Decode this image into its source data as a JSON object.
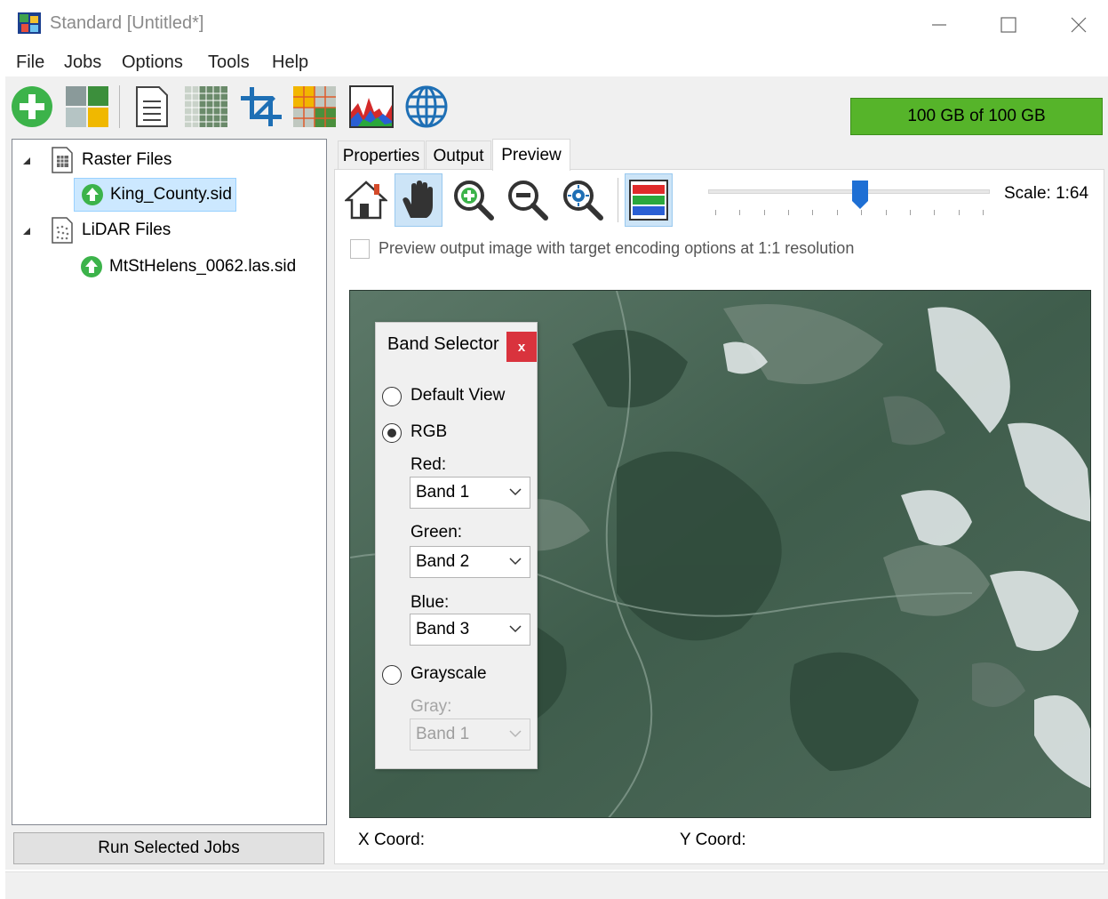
{
  "window": {
    "title": "Standard [Untitled*]"
  },
  "menu": [
    "File",
    "Jobs",
    "Options",
    "Tools",
    "Help"
  ],
  "toolbar": {
    "buttons": [
      {
        "icon": "add-job-icon"
      },
      {
        "icon": "mosaic-icon"
      },
      {
        "icon": "properties-document-icon"
      },
      {
        "icon": "grid-tiles-icon"
      },
      {
        "icon": "crop-icon"
      },
      {
        "icon": "mosaic-grid-icon"
      },
      {
        "icon": "histogram-chart-icon"
      },
      {
        "icon": "globe-icon"
      }
    ],
    "storage_label": "100 GB of 100 GB",
    "storage_used_fraction": 1.0,
    "storage_color": "#56b42a"
  },
  "tree": {
    "groups": [
      {
        "label": "Raster Files",
        "expanded": true,
        "items": [
          {
            "label": "King_County.sid",
            "selected": true
          }
        ]
      },
      {
        "label": "LiDAR Files",
        "expanded": true,
        "items": [
          {
            "label": "MtStHelens_0062.las.sid",
            "selected": false
          }
        ]
      }
    ]
  },
  "run_button": "Run Selected Jobs",
  "tabs": [
    {
      "label": "Properties",
      "active": false
    },
    {
      "label": "Output",
      "active": false
    },
    {
      "label": "Preview",
      "active": true
    }
  ],
  "preview": {
    "tools": [
      "home-icon",
      "pan-hand-icon",
      "zoom-in-icon",
      "zoom-out-icon",
      "zoom-fit-icon",
      "band-selector-icon"
    ],
    "active_tool": "pan-hand-icon",
    "scale_label": "Scale: 1:64",
    "slider_fraction": 0.54,
    "checkbox_label": "Preview output image with target encoding options at 1:1 resolution",
    "checkbox_checked": false,
    "x_coord_label": "X Coord:",
    "y_coord_label": "Y Coord:"
  },
  "band_selector": {
    "title": "Band Selector",
    "close": "x",
    "options": {
      "default_view": "Default View",
      "rgb": "RGB",
      "grayscale": "Grayscale"
    },
    "selected": "rgb",
    "red_label": "Red:",
    "red_value": "Band 1",
    "green_label": "Green:",
    "green_value": "Band 2",
    "blue_label": "Blue:",
    "blue_value": "Band 3",
    "gray_label": "Gray:",
    "gray_value": "Band 1"
  }
}
